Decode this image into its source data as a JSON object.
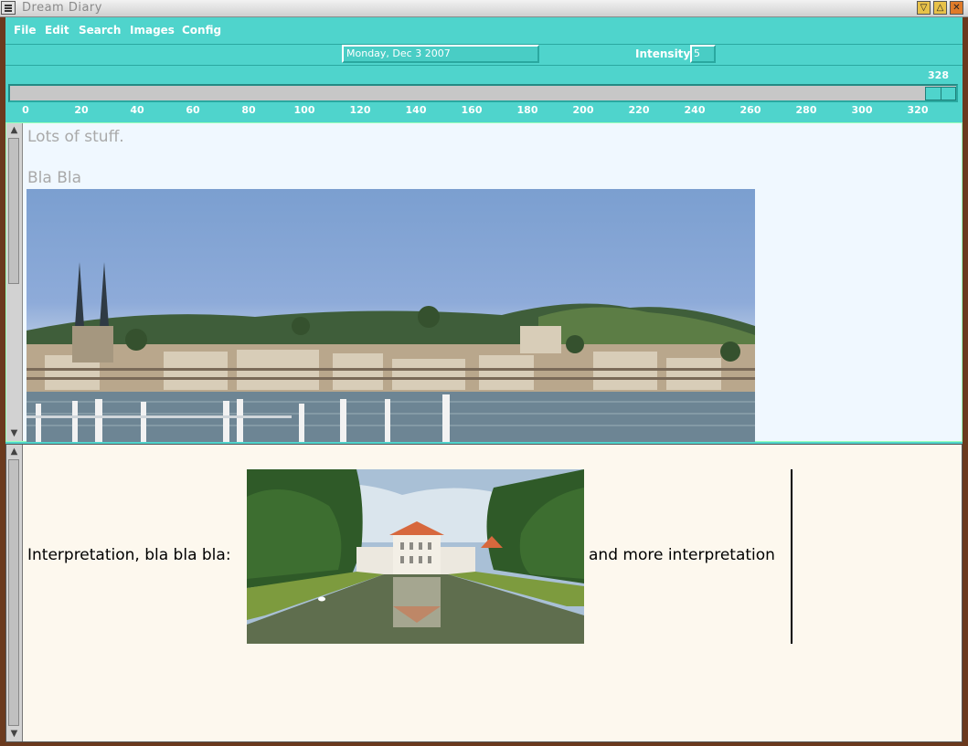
{
  "window": {
    "title": "Dream Diary",
    "controls": [
      "minimize",
      "maximize",
      "close"
    ]
  },
  "menu": {
    "items": [
      "File",
      "Edit",
      "Search",
      "Images",
      "Config"
    ]
  },
  "toolbar": {
    "date_value": "Monday, Dec  3 2007",
    "intensity_label": "Intensity:",
    "intensity_value": "5"
  },
  "slider": {
    "current_value": "328",
    "ticks": [
      "0",
      "20",
      "40",
      "60",
      "80",
      "100",
      "120",
      "140",
      "160",
      "180",
      "200",
      "220",
      "240",
      "260",
      "280",
      "300",
      "320"
    ]
  },
  "upper_pane": {
    "line1": "Lots of stuff.",
    "line2": "Bla Bla",
    "image": "lake-city-panorama"
  },
  "lower_pane": {
    "text_before": "Interpretation, bla bla bla:",
    "text_after": "and more interpretation",
    "image": "palace-canal-photo"
  },
  "colors": {
    "accent": "#4fd4cc",
    "upper_bg": "#f0f8ff",
    "lower_bg": "#fdf8ee"
  }
}
